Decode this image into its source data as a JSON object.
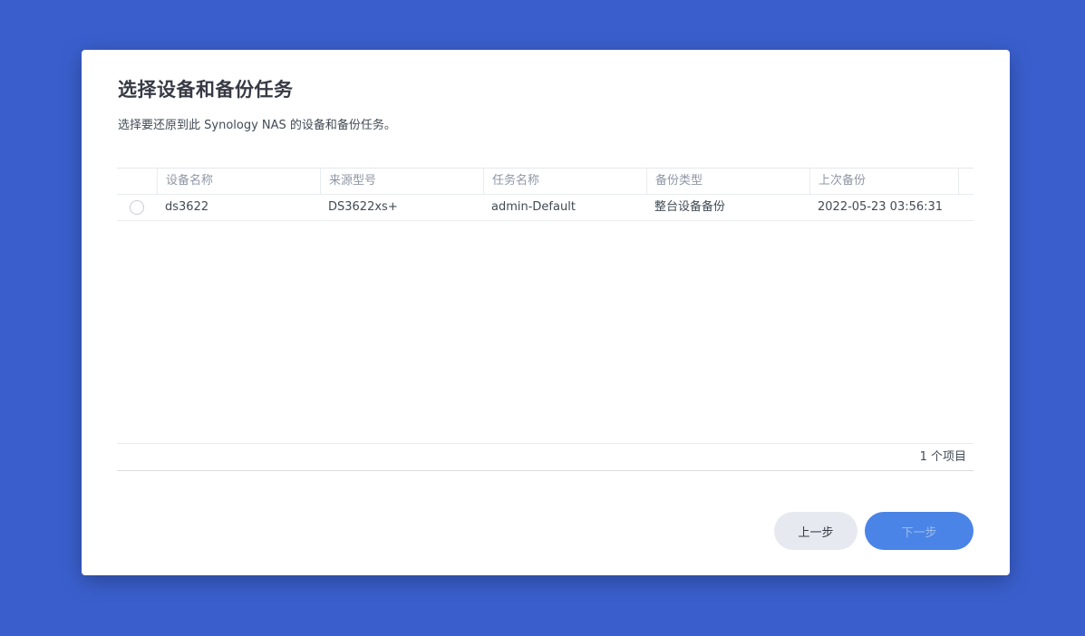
{
  "dialog": {
    "title": "选择设备和备份任务",
    "subtitle": "选择要还原到此 Synology NAS 的设备和备份任务。"
  },
  "table": {
    "columns": [
      "设备名称",
      "来源型号",
      "任务名称",
      "备份类型",
      "上次备份"
    ],
    "rows": [
      [
        "ds3622",
        "DS3622xs+",
        "admin-Default",
        "整台设备备份",
        "2022-05-23 03:56:31"
      ]
    ],
    "item_count": "1 个项目"
  },
  "buttons": {
    "prev": "上一步",
    "next": "下一步"
  },
  "colors": {
    "background": "#3a5fcd",
    "primary": "#4a84e6",
    "secondary": "#e6e9ef"
  }
}
